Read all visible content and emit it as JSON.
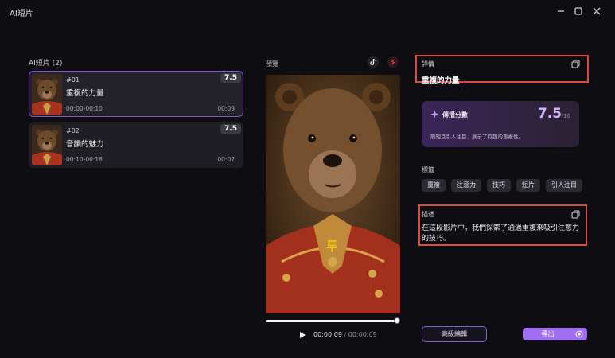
{
  "window": {
    "title": "AI短片"
  },
  "clip_list": {
    "title": "AI短片 (2)",
    "clips": [
      {
        "index": "#01",
        "name": "重複的力量",
        "range": "00:00-00:10",
        "duration": "00:09",
        "score": "7.5"
      },
      {
        "index": "#02",
        "name": "音韻的魅力",
        "range": "00:10-00:18",
        "duration": "00:07",
        "score": "7.5"
      }
    ]
  },
  "preview": {
    "label": "預覽",
    "caption": "투",
    "current_time": "00:00:09",
    "separator": "/",
    "total_time": "00:00:09",
    "progress_fraction": 1.0
  },
  "details": {
    "label": "詳情",
    "clip_name": "重複的力量",
    "score_card": {
      "title": "傳播分數",
      "value": "7.5",
      "max": "/10",
      "description": "簡短且引人注目，展示了有趣的重複性。"
    },
    "tags_label": "標籤",
    "tags": [
      "重複",
      "注意力",
      "技巧",
      "短片",
      "引人注目"
    ],
    "description_label": "描述",
    "description": "在這段影片中，我們探索了通過重複來吸引注意力的技巧。"
  },
  "actions": {
    "advanced_edit": "高級編輯",
    "export": "導出"
  },
  "colors": {
    "accent": "#a06ef0",
    "highlight_box": "#e0493f",
    "score": "#d6b4ff"
  },
  "icons": [
    "minimize-icon",
    "maximize-icon",
    "close-icon",
    "tiktok-icon",
    "youtube-shorts-icon",
    "copy-icon",
    "sparkle-icon",
    "play-icon",
    "export-icon"
  ]
}
